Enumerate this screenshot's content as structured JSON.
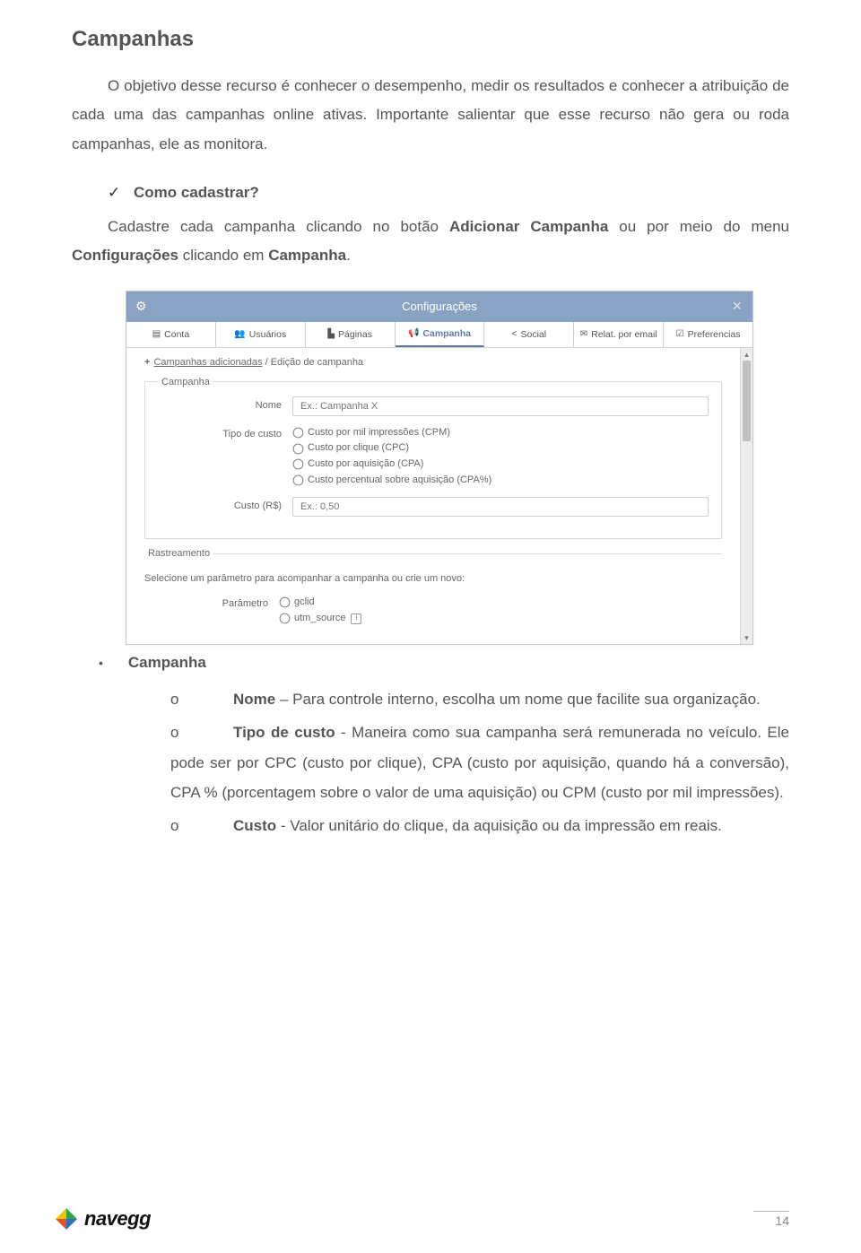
{
  "heading": "Campanhas",
  "intro": "O objetivo desse recurso é conhecer o desempenho, medir os resultados e conhecer a atribuição de cada uma das campanhas online ativas. Importante salientar que esse recurso não gera ou roda campanhas, ele as monitora.",
  "howto_title": "Como cadastrar?",
  "howto_text_pre": "Cadastre cada campanha clicando no botão ",
  "howto_bold1": "Adicionar Campanha",
  "howto_mid": " ou por meio do menu ",
  "howto_bold2": "Configurações",
  "howto_mid2": " clicando em ",
  "howto_bold3": "Campanha",
  "howto_end": ".",
  "shot": {
    "header_title": "Configurações",
    "gear": "⚙",
    "close": "×",
    "tabs": [
      {
        "icon": "▤",
        "label": "Conta"
      },
      {
        "icon": "👥",
        "label": "Usuários"
      },
      {
        "icon": "▙",
        "label": "Páginas"
      },
      {
        "icon": "📢",
        "label": "Campanha"
      },
      {
        "icon": "<",
        "label": "Social"
      },
      {
        "icon": "✉",
        "label": "Relat. por email"
      },
      {
        "icon": "☑",
        "label": "Preferencias"
      }
    ],
    "breadcrumb_plus": "+",
    "breadcrumb_link": "Campanhas adicionadas",
    "breadcrumb_sep": " / ",
    "breadcrumb_tail": "Edição de campanha",
    "fieldset_campanha": {
      "legend": "Campanha",
      "rows": {
        "nome": {
          "label": "Nome",
          "placeholder": "Ex.: Campanha X"
        },
        "tipo": {
          "label": "Tipo de custo",
          "options": [
            "Custo por mil impressões (CPM)",
            "Custo por clique (CPC)",
            "Custo por aquisição (CPA)",
            "Custo percentual sobre aquisição (CPA%)"
          ]
        },
        "custo": {
          "label": "Custo (R$)",
          "placeholder": "Ex.: 0,50"
        }
      }
    },
    "fieldset_rastreamento": {
      "legend": "Rastreamento",
      "hint": "Selecione um parâmetro para acompanhar a campanha ou crie um novo:",
      "param_label": "Parâmetro",
      "options": [
        "gclid",
        "utm_source"
      ],
      "info": "i"
    }
  },
  "bullet_title": "Campanha",
  "sub": {
    "nome": {
      "bold": "Nome",
      "text": " – Para controle interno, escolha um nome que facilite sua organização."
    },
    "tipo": {
      "bold": "Tipo de custo",
      "text": " - Maneira como sua campanha será remunerada no veículo. Ele pode ser por CPC (custo por clique), CPA (custo por aquisição, quando há a conversão), CPA % (porcentagem sobre o valor de uma aquisição) ou CPM (custo por mil impressões)."
    },
    "custo": {
      "bold": "Custo",
      "text": " - Valor unitário do clique, da aquisição ou da impressão em reais."
    }
  },
  "footer": {
    "brand": "navegg",
    "page": "14"
  }
}
